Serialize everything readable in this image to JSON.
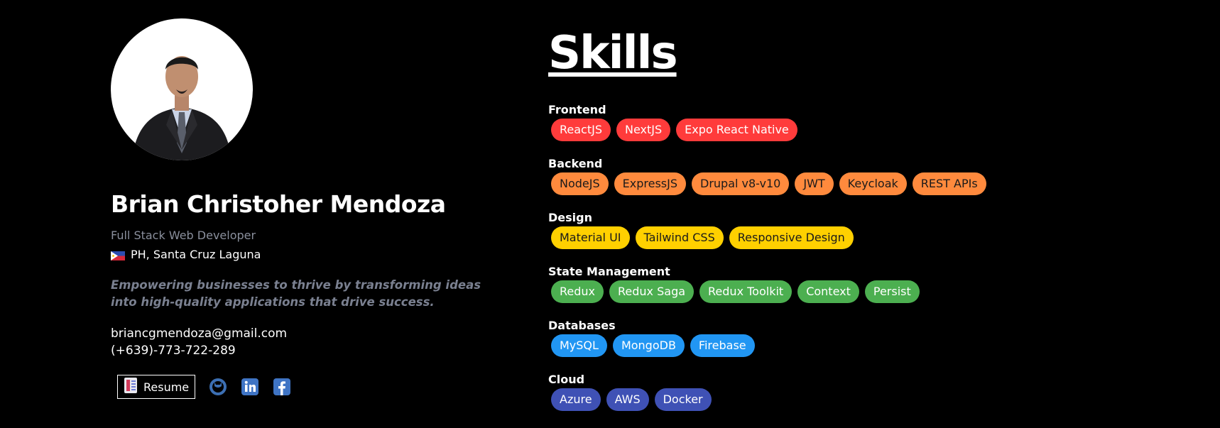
{
  "profile": {
    "name": "Brian Christoher Mendoza",
    "role": "Full Stack Web Developer",
    "location": "PH, Santa Cruz Laguna",
    "tagline": "Empowering businesses to thrive by transforming ideas into high-quality applications that drive success.",
    "email": "briancgmendoza@gmail.com",
    "phone": "(+639)-773-722-289"
  },
  "links": {
    "resume_label": "Resume",
    "icons": [
      "github-icon",
      "linkedin-icon",
      "facebook-icon"
    ]
  },
  "skills": {
    "title": "Skills",
    "categories": [
      {
        "name": "Frontend",
        "color": "#ff3b3b",
        "text_color": "#ffffff",
        "items": [
          "ReactJS",
          "NextJS",
          "Expo React Native"
        ]
      },
      {
        "name": "Backend",
        "color": "#ff8a3d",
        "text_color": "#1a1a1a",
        "items": [
          "NodeJS",
          "ExpressJS",
          "Drupal v8-v10",
          "JWT",
          "Keycloak",
          "REST APIs"
        ]
      },
      {
        "name": "Design",
        "color": "#ffd000",
        "text_color": "#1a1a1a",
        "items": [
          "Material UI",
          "Tailwind CSS",
          "Responsive Design"
        ]
      },
      {
        "name": "State Management",
        "color": "#4caf50",
        "text_color": "#ffffff",
        "items": [
          "Redux",
          "Redux Saga",
          "Redux Toolkit",
          "Context",
          "Persist"
        ]
      },
      {
        "name": "Databases",
        "color": "#2196f3",
        "text_color": "#ffffff",
        "items": [
          "MySQL",
          "MongoDB",
          "Firebase"
        ]
      },
      {
        "name": "Cloud",
        "color": "#3f51b5",
        "text_color": "#ffffff",
        "items": [
          "Azure",
          "AWS",
          "Docker"
        ]
      }
    ]
  }
}
